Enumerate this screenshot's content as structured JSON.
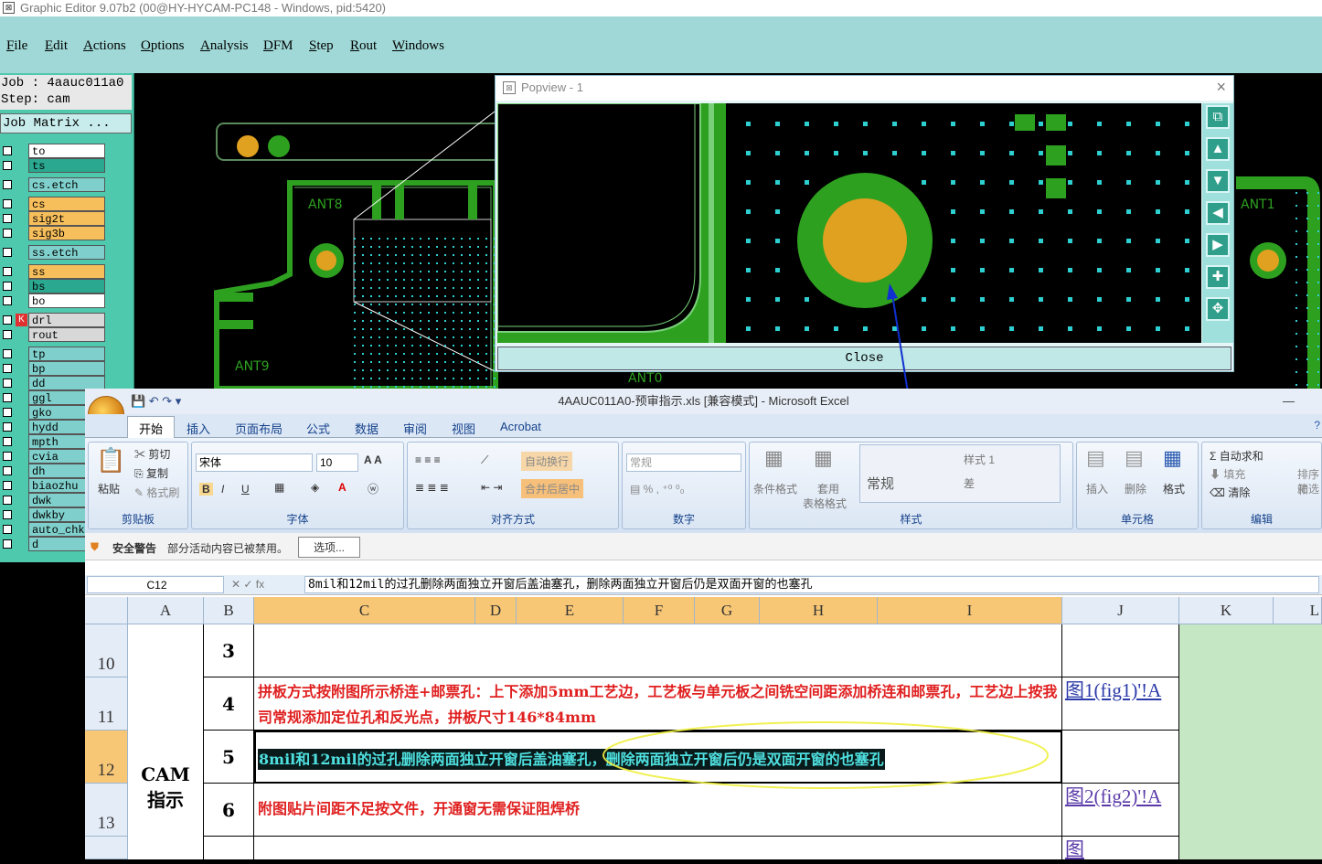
{
  "app": {
    "title": "Graphic Editor 9.07b2 (00@HY-HYCAM-PC148 - Windows, pid:5420)",
    "menu": [
      "File",
      "Edit",
      "Actions",
      "Options",
      "Analysis",
      "DFM",
      "Step",
      "Rout",
      "Windows"
    ]
  },
  "job": {
    "job_line": "Job : 4aauc011a0",
    "step_line": "Step: cam",
    "matrix_button": "Job Matrix ..."
  },
  "layers": [
    {
      "name": "to",
      "style": "w"
    },
    {
      "name": "ts",
      "style": "g"
    },
    {
      "name": "cs.etch",
      "style": "c"
    },
    {
      "name": "cs",
      "style": "o"
    },
    {
      "name": "sig2t",
      "style": "o"
    },
    {
      "name": "sig3b",
      "style": "o"
    },
    {
      "name": "ss.etch",
      "style": "c"
    },
    {
      "name": "ss",
      "style": "o"
    },
    {
      "name": "bs",
      "style": "g"
    },
    {
      "name": "bo",
      "style": "w"
    },
    {
      "name": "drl",
      "style": "gr"
    },
    {
      "name": "rout",
      "style": "gr"
    },
    {
      "name": "tp",
      "style": "c"
    },
    {
      "name": "bp",
      "style": "c"
    },
    {
      "name": "dd",
      "style": "c"
    },
    {
      "name": "ggl",
      "style": "c"
    },
    {
      "name": "gko",
      "style": "c"
    },
    {
      "name": "hydd",
      "style": "c"
    },
    {
      "name": "mpth",
      "style": "c"
    },
    {
      "name": "cvia",
      "style": "c"
    },
    {
      "name": "dh",
      "style": "c"
    },
    {
      "name": "biaozhu",
      "style": "c"
    },
    {
      "name": "dwk",
      "style": "c"
    },
    {
      "name": "dwkby",
      "style": "c"
    },
    {
      "name": "auto_chk",
      "style": "c"
    },
    {
      "name": "d",
      "style": "c"
    }
  ],
  "board_labels": [
    "ANT8",
    "ANT9",
    "ANT0",
    "ANT1"
  ],
  "popview": {
    "title": "Popview - 1",
    "close_label": "Close",
    "close_x": "×"
  },
  "excel": {
    "title": "4AAUC011A0-预审指示.xls  [兼容模式] - Microsoft Excel",
    "tabs": [
      "开始",
      "插入",
      "页面布局",
      "公式",
      "数据",
      "审阅",
      "视图",
      "Acrobat"
    ],
    "clipboard": {
      "paste": "粘贴",
      "cut": "剪切",
      "copy": "复制",
      "format_painter": "格式刷",
      "label": "剪贴板"
    },
    "font": {
      "name": "宋体",
      "size": "10",
      "label": "字体"
    },
    "alignment": {
      "wrap": "自动换行",
      "merge": "合并后居中",
      "label": "对齐方式"
    },
    "number": {
      "format": "常规",
      "label": "数字"
    },
    "styles": {
      "cond": "条件格式",
      "table": "套用",
      "table2": "表格格式",
      "normal": "常规",
      "style1": "样式 1",
      "bad": "差",
      "label": "样式"
    },
    "cells": {
      "insert": "插入",
      "delete": "删除",
      "format": "格式",
      "label": "单元格"
    },
    "editing": {
      "autosum": "自动求和",
      "fill": "填充",
      "clear": "清除",
      "sort": "排序和",
      "sort2": "筛选",
      "label": "编辑"
    },
    "security": {
      "title": "安全警告",
      "message": "部分活动内容已被禁用。",
      "options": "选项..."
    },
    "name_box": "C12",
    "formula": "8mil和12mil的过孔删除两面独立开窗后盖油塞孔，删除两面独立开窗后仍是双面开窗的也塞孔",
    "columns": [
      "A",
      "B",
      "C",
      "D",
      "E",
      "F",
      "G",
      "H",
      "I",
      "J",
      "K",
      "L"
    ],
    "rows": [
      {
        "num": "10",
        "b": "3",
        "text": "",
        "link": ""
      },
      {
        "num": "11",
        "b": "4",
        "text": "拼板方式按附图所示桥连+邮票孔：上下添加5mm工艺边，工艺板与单元板之间铣空间距添加桥连和邮票孔，工艺边上按我司常规添加定位孔和反光点，拼板尺寸146*84mm",
        "link": "图1(fig1)'!A"
      },
      {
        "num": "12",
        "b": "5",
        "text": "8mil和12mil的过孔删除两面独立开窗后盖油塞孔，删除两面独立开窗后仍是双面开窗的也塞孔",
        "link": ""
      },
      {
        "num": "13",
        "b": "6",
        "text": "附图贴片间距不足按文件，开通窗无需保证阻焊桥",
        "link": "图2(fig2)'!A"
      },
      {
        "num": "",
        "b": "",
        "text": "",
        "link": "图"
      }
    ],
    "merged_label": "CAM\n指示"
  }
}
